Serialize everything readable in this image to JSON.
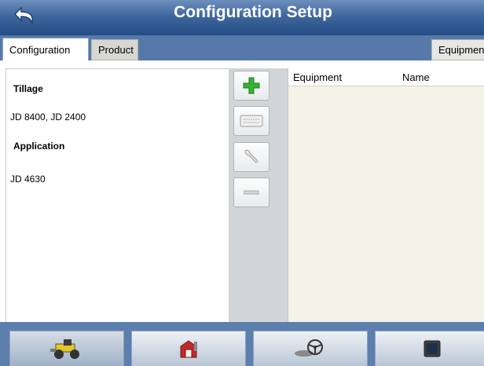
{
  "header": {
    "title": "Configuration Setup"
  },
  "tabs": [
    {
      "label": "Configuration",
      "active": true
    },
    {
      "label": "Product",
      "active": false
    },
    {
      "label": "Equipment",
      "active": false
    }
  ],
  "config_list": {
    "groups": [
      {
        "label": "Tillage",
        "items": [
          "JD 8400, JD 2400"
        ]
      },
      {
        "label": "Application",
        "items": [
          "JD 4630"
        ]
      }
    ]
  },
  "toolbar": {
    "add_icon": "plus-icon",
    "keyboard_icon": "keyboard-icon",
    "settings_icon": "wrench-icon",
    "remove_icon": "minus-icon"
  },
  "equipment_table": {
    "columns": [
      "Equipment",
      "Name"
    ],
    "rows": []
  },
  "bottom_nav": [
    {
      "icon": "tractor-icon"
    },
    {
      "icon": "barn-icon"
    },
    {
      "icon": "steering-wheel-icon"
    },
    {
      "icon": "display-icon"
    }
  ],
  "colors": {
    "header_blue": "#2e5a94",
    "add_green": "#2fa52f",
    "panel_bg": "#f3f3ea"
  }
}
